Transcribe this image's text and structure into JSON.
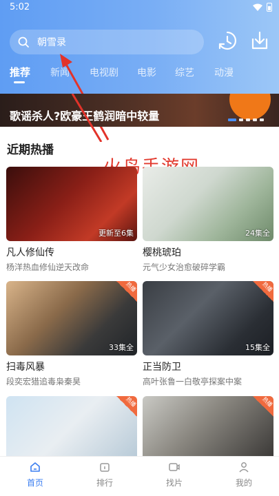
{
  "status": {
    "time": "5:02"
  },
  "search": {
    "query": "朝雪录"
  },
  "tabs": [
    "推荐",
    "新闻",
    "电视剧",
    "电影",
    "综艺",
    "动漫"
  ],
  "banner": {
    "title": "歌谣杀人?欧豪王鹤润暗中较量"
  },
  "section": {
    "title": "近期热播"
  },
  "watermark": "火鸟手游网",
  "cards": [
    {
      "title": "凡人修仙传",
      "subtitle": "杨洋热血修仙逆天改命",
      "tag": "更新至6集"
    },
    {
      "title": "樱桃琥珀",
      "subtitle": "元气少女治愈破碎学霸",
      "tag": "24集全"
    },
    {
      "title": "扫毒风暴",
      "subtitle": "段奕宏猎追毒枭秦昊",
      "tag": "33集全"
    },
    {
      "title": "正当防卫",
      "subtitle": "高叶张鲁一白敬亭探案中案",
      "tag": "15集全"
    },
    {
      "title": "",
      "subtitle": "",
      "tag": ""
    },
    {
      "title": "",
      "subtitle": "",
      "tag": ""
    }
  ],
  "badges": {
    "hot": "热播"
  },
  "nav": [
    "首页",
    "排行",
    "找片",
    "我的"
  ],
  "colors": {
    "accent": "#3a7df0",
    "header": "#6aa4f4",
    "watermark": "#e23a2e"
  }
}
